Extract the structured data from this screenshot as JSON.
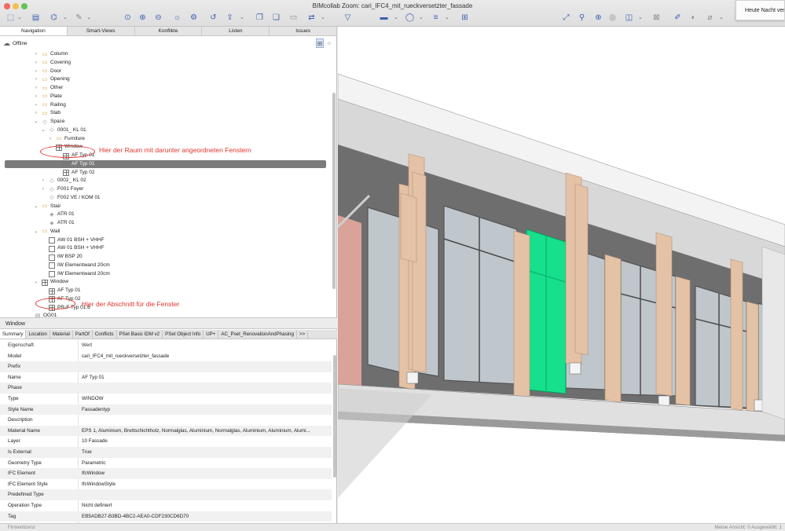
{
  "window": {
    "title": "BIMcollab Zoom: cari_IFC4_mit_rueckversetzter_fassade"
  },
  "notification": {
    "text": "Heute Nacht ver"
  },
  "nav_tabs": [
    "Navigation",
    "Smart-Views",
    "Konflikte",
    "Listen",
    "Issues"
  ],
  "status_offline": "Offline",
  "tree": [
    {
      "label": "Column",
      "level": 2,
      "icon": "folder-icon",
      "chevron": "right"
    },
    {
      "label": "Covering",
      "level": 2,
      "icon": "folder-icon",
      "chevron": "right"
    },
    {
      "label": "Door",
      "level": 2,
      "icon": "folder-icon",
      "chevron": "right"
    },
    {
      "label": "Opening",
      "level": 2,
      "icon": "folder-icon",
      "chevron": "right"
    },
    {
      "label": "Other",
      "level": 2,
      "icon": "folder-icon",
      "chevron": "right"
    },
    {
      "label": "Plate",
      "level": 2,
      "icon": "folder-icon",
      "chevron": "right"
    },
    {
      "label": "Railing",
      "level": 2,
      "icon": "folder-icon",
      "chevron": "right"
    },
    {
      "label": "Slab",
      "level": 2,
      "icon": "folder-icon",
      "chevron": "right"
    },
    {
      "label": "Space",
      "level": 2,
      "icon": "space-icon",
      "chevron": "down"
    },
    {
      "label": "0001_ KL 01",
      "level": 3,
      "icon": "space-icon",
      "chevron": "down"
    },
    {
      "label": "Furniture",
      "level": 4,
      "icon": "folder-icon",
      "chevron": "right"
    },
    {
      "label": "Window",
      "level": 4,
      "icon": "window-icon",
      "chevron": "down"
    },
    {
      "label": "AF Typ 01",
      "level": 5,
      "icon": "window-icon",
      "chevron": ""
    },
    {
      "label": "AF Typ 01",
      "level": 5,
      "icon": "window-icon",
      "chevron": "",
      "selected": true
    },
    {
      "label": "AF Typ 02",
      "level": 5,
      "icon": "window-icon",
      "chevron": ""
    },
    {
      "label": "0002_ KL 02",
      "level": 3,
      "icon": "space-icon",
      "chevron": "right"
    },
    {
      "label": "F001 Foyer",
      "level": 3,
      "icon": "space-icon",
      "chevron": "right"
    },
    {
      "label": "F002 VE / KOM 01",
      "level": 3,
      "icon": "space-icon",
      "chevron": ""
    },
    {
      "label": "Stair",
      "level": 2,
      "icon": "folder-icon",
      "chevron": "down"
    },
    {
      "label": "ATR 01",
      "level": 3,
      "icon": "stair-icon",
      "chevron": ""
    },
    {
      "label": "ATR 01",
      "level": 3,
      "icon": "stair-icon",
      "chevron": ""
    },
    {
      "label": "Wall",
      "level": 2,
      "icon": "folder-icon",
      "chevron": "down"
    },
    {
      "label": "AW 01 BSH + VHHF",
      "level": 3,
      "icon": "wall-icon",
      "chevron": ""
    },
    {
      "label": "AW 01 BSH + VHHF",
      "level": 3,
      "icon": "wall-icon",
      "chevron": ""
    },
    {
      "label": "IW BSP 20",
      "level": 3,
      "icon": "wall-icon",
      "chevron": ""
    },
    {
      "label": "IW Elementwand 20cm",
      "level": 3,
      "icon": "wall-icon",
      "chevron": ""
    },
    {
      "label": "IW Elementwand 20cm",
      "level": 3,
      "icon": "wall-icon",
      "chevron": ""
    },
    {
      "label": "Window",
      "level": 2,
      "icon": "window-icon",
      "chevron": "down"
    },
    {
      "label": "AF Typ 01",
      "level": 3,
      "icon": "window-icon",
      "chevron": ""
    },
    {
      "label": "AF Typ 02",
      "level": 3,
      "icon": "window-icon",
      "chevron": ""
    },
    {
      "label": "PR-F Typ 01.6",
      "level": 3,
      "icon": "window-icon",
      "chevron": ""
    },
    {
      "label": "OG01",
      "level": 1,
      "icon": "storey-icon",
      "chevron": ""
    }
  ],
  "annotations": {
    "space_note": "Hier der Raum mit darunter angeordneten Fenstern",
    "window_note": "Hier der Abschnitt für die Fenster"
  },
  "properties": {
    "title": "Window",
    "tabs": [
      "Summary",
      "Location",
      "Material",
      "PartOf",
      "Conflicts",
      "PSet Basic IDM v2",
      "PSet Object Info",
      "UP+",
      "AC_Pset_RenovationAndPhasing",
      ">>"
    ],
    "header": {
      "key": "Eigenschaft",
      "value": "Wert"
    },
    "rows": [
      {
        "key": "Model",
        "value": "cari_IFC4_mit_rueckversetzter_fassade"
      },
      {
        "key": "Prefix",
        "value": ""
      },
      {
        "key": "Name",
        "value": "AF Typ 01"
      },
      {
        "key": "Phase",
        "value": ""
      },
      {
        "key": "Type",
        "value": "WINDOW"
      },
      {
        "key": "Style Name",
        "value": "Fassadentyp"
      },
      {
        "key": "Description",
        "value": ""
      },
      {
        "key": "Material Name",
        "value": "EPS 1, Aluminium, Brettschichtholz, Normalglas, Aluminium, Normalglas, Aluminium, Aluminium, Alumi..."
      },
      {
        "key": "Layer",
        "value": "10 Fassade"
      },
      {
        "key": "Is External",
        "value": "True"
      },
      {
        "key": "Geometry Type",
        "value": "Parametric"
      },
      {
        "key": "IFC Element",
        "value": "IfcWindow"
      },
      {
        "key": "IFC Element Style",
        "value": "IfcWindowStyle"
      },
      {
        "key": "Predefined Type",
        "value": ""
      },
      {
        "key": "Operation Type",
        "value": "Nicht definiert"
      },
      {
        "key": "Tag",
        "value": "EB5ADB27-B3BD-4BC2-AEA0-CDF230CD6D70"
      }
    ]
  },
  "statusbar": {
    "left": "Firmenlizenz",
    "right": "Meine Ansicht: 0   Ausgewählt: 1"
  },
  "colors": {
    "selection_green": "#16e08c",
    "annotation_red": "#e0352b",
    "timber": "#e3c2a6",
    "facade_grey": "#6e6e6e"
  }
}
